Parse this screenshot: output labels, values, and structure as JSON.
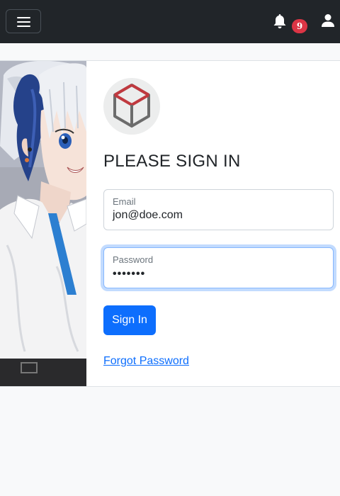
{
  "navbar": {
    "menu_icon": "hamburger-menu-icon",
    "notification_icon": "bell-icon",
    "notification_count": "9",
    "user_icon": "person-icon"
  },
  "login": {
    "logo_icon": "cube-logo-icon",
    "title": "PLEASE SIGN IN",
    "email": {
      "label": "Email",
      "value": "jon@doe.com"
    },
    "password": {
      "label": "Password",
      "value": "•••••••"
    },
    "submit_label": "Sign In",
    "forgot_label": "Forgot Password"
  },
  "colors": {
    "navbar_bg": "#212529",
    "badge": "#dc3545",
    "primary": "#0d6efd",
    "logo_red": "#c0393f",
    "logo_gray": "#6c6c6c"
  }
}
